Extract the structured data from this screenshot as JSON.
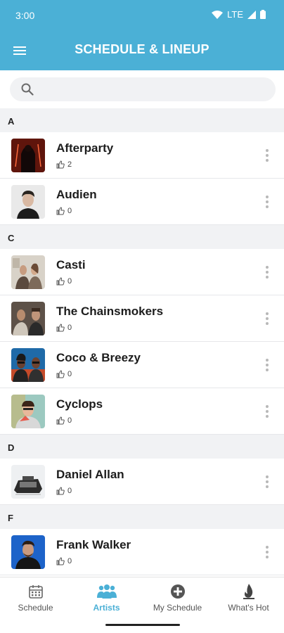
{
  "status_bar": {
    "time": "3:00",
    "network": "LTE"
  },
  "app_bar": {
    "title": "SCHEDULE & LINEUP"
  },
  "search": {
    "placeholder": ""
  },
  "sections": [
    {
      "letter": "A",
      "artists": [
        {
          "name": "Afterparty",
          "likes": "2"
        },
        {
          "name": "Audien",
          "likes": "0"
        }
      ]
    },
    {
      "letter": "C",
      "artists": [
        {
          "name": "Casti",
          "likes": "0"
        },
        {
          "name": "The Chainsmokers",
          "likes": "0"
        },
        {
          "name": "Coco & Breezy",
          "likes": "0"
        },
        {
          "name": "Cyclops",
          "likes": "0"
        }
      ]
    },
    {
      "letter": "D",
      "artists": [
        {
          "name": "Daniel Allan",
          "likes": "0"
        }
      ]
    },
    {
      "letter": "F",
      "artists": [
        {
          "name": "Frank Walker",
          "likes": "0"
        }
      ]
    }
  ],
  "bottom_nav": [
    {
      "label": "Schedule",
      "icon": "calendar-icon",
      "active": false
    },
    {
      "label": "Artists",
      "icon": "people-icon",
      "active": true
    },
    {
      "label": "My Schedule",
      "icon": "plus-circle-icon",
      "active": false
    },
    {
      "label": "What's Hot",
      "icon": "flame-icon",
      "active": false
    }
  ],
  "colors": {
    "accent": "#4bb0d6",
    "section_bg": "#f1f2f4"
  }
}
